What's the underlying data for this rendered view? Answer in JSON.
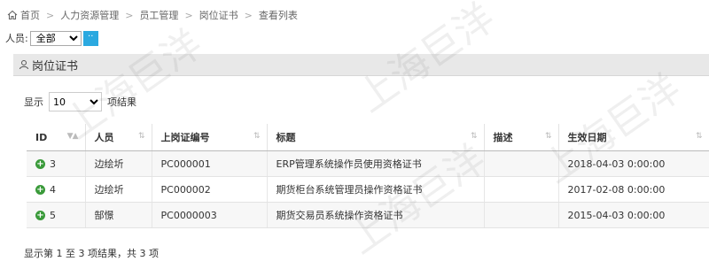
{
  "breadcrumb": {
    "items": [
      "首页",
      "人力资源管理",
      "员工管理",
      "岗位证书",
      "查看列表"
    ]
  },
  "filter": {
    "label": "人员:",
    "selected": "全部",
    "search_btn": "··"
  },
  "panel": {
    "title": "岗位证书"
  },
  "length": {
    "prefix": "显示",
    "selected": "10",
    "suffix": "项结果"
  },
  "table": {
    "columns": [
      "ID",
      "人员",
      "上岗证编号",
      "标题",
      "描述",
      "生效日期"
    ],
    "rows": [
      {
        "id": "3",
        "person": "边绘圻",
        "code": "PC000001",
        "title": "ERP管理系统操作员使用资格证书",
        "desc": "",
        "date": "2018-04-03 0:00:00"
      },
      {
        "id": "4",
        "person": "边绘圻",
        "code": "PC000002",
        "title": "期货柜台系统管理员操作资格证书",
        "desc": "",
        "date": "2017-02-08 0:00:00"
      },
      {
        "id": "5",
        "person": "郜憬",
        "code": "PC0000003",
        "title": "期货交易员系统操作资格证书",
        "desc": "",
        "date": "2015-04-03 0:00:00"
      }
    ]
  },
  "info": "显示第 1 至 3 项结果，共 3 项",
  "watermark": "上海巨洋",
  "accent_color": "#2ba9e0"
}
